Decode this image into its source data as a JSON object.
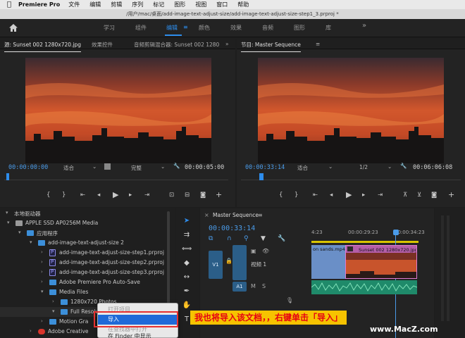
{
  "menubar": {
    "app_name": "Premiere Pro",
    "items": [
      "文件",
      "编辑",
      "剪辑",
      "序列",
      "标记",
      "图形",
      "视图",
      "窗口",
      "帮助"
    ]
  },
  "titlebar": {
    "path": "/用户/mac/桌面/add-image-text-adjust-size/add-image-text-adjust-size-step1_3.prproj *"
  },
  "workspace": {
    "tabs": [
      "学习",
      "组件",
      "编辑",
      "颜色",
      "效果",
      "音频",
      "图形",
      "库"
    ],
    "active_index": 2,
    "more": "»"
  },
  "source_monitor": {
    "tabs": [
      "源: Sunset 002 1280x720.jpg",
      "效果控件",
      "音频剪辑混合器: Sunset 002 1280"
    ],
    "timecode_in": "00:00:00:00",
    "fit_label": "适合",
    "quality_label": "完整",
    "duration": "00:00:05:00"
  },
  "program_monitor": {
    "tab": "节目: Master Sequence",
    "timecode": "00:00:33:14",
    "fit_label": "适合",
    "zoom": "1/2",
    "duration": "00:06:06:08"
  },
  "project": {
    "header": "本地驱动器",
    "rows": [
      {
        "label": "APPLE SSD AP0256M Media",
        "type": "drive",
        "indent": 22
      },
      {
        "label": "应用程序",
        "type": "folder",
        "indent": 38
      },
      {
        "label": "add-image-text-adjust-size 2",
        "type": "folder",
        "indent": 54
      },
      {
        "label": "add-image-text-adjust-size-step1.prproj",
        "type": "file",
        "indent": 70
      },
      {
        "label": "add-image-text-adjust-size-step2.prproj",
        "type": "file",
        "indent": 70
      },
      {
        "label": "add-image-text-adjust-size-step3.prproj",
        "type": "file",
        "indent": 70
      },
      {
        "label": "Adobe Premiere Pro Auto-Save",
        "type": "folder",
        "indent": 70
      },
      {
        "label": "Media Files",
        "type": "folder",
        "indent": 70
      },
      {
        "label": "1280x720 Photos",
        "type": "folder",
        "indent": 86
      },
      {
        "label": "Full Resolution Photos",
        "type": "folder",
        "indent": 86
      },
      {
        "label": "Motion Gra",
        "type": "folder",
        "indent": 70
      },
      {
        "label": "Adobe Creative",
        "type": "cc",
        "indent": 54
      }
    ]
  },
  "timeline": {
    "tab": "Master Sequence",
    "timecode": "00:00:33:14",
    "ruler": [
      "4:23",
      "00:00:29:23",
      "00:00:34:23"
    ],
    "track_v1": "V1",
    "track_v1_name": "视频 1",
    "track_a1": "A1",
    "clip_1": "on sands.mp4",
    "clip_2": "Sunset 002 1280x720.jpg"
  },
  "context_menu": {
    "items": [
      "打开项目",
      "导入",
      "在查找器中打开",
      "在 Finder 中显示"
    ],
    "selected_index": 1
  },
  "annotation": {
    "caption": "我也将导入该文档，，右键单击「导入」"
  },
  "watermark": "www.MacZ.com",
  "colors": {
    "accent": "#2d8ceb",
    "highlight": "#1f6ad8",
    "caption_bg": "#f6c300",
    "caption_text": "#e60012"
  }
}
